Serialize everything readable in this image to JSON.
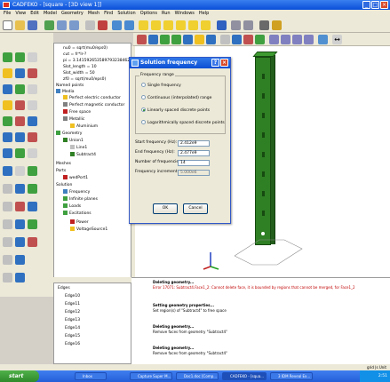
{
  "window": {
    "title": "CADFEKO - [square - [3D view 1]]"
  },
  "menu": [
    "File",
    "View",
    "Edit",
    "Model",
    "Geometry",
    "Mesh",
    "Find",
    "Solution",
    "Options",
    "Run",
    "Windows",
    "Help"
  ],
  "tree": {
    "items": [
      "nu0 = sqrt(mu0/eps0)",
      "cut = fr*lr-?",
      "pi = 3.141592653589793238462",
      "Slot_length = 10",
      "Slot_width = 50",
      "zf0 = sqrt(mu0/eps0)",
      "Named points",
      "Media",
      "Perfect electric conductor",
      "Perfect magnetic conductor",
      "Free space",
      "Metallic",
      "Aluminium",
      "Geometry",
      "Union1",
      "Line1",
      "Subtract4",
      "Meshes",
      "Ports",
      "wedPort1",
      "Solution",
      "Frequency",
      "Infinite planes",
      "Loads",
      "Excitations",
      "Power",
      "VoltageSource1"
    ]
  },
  "lower_tree": {
    "items": [
      "Edges",
      "Edge10",
      "Edge11",
      "Edge12",
      "Edge13",
      "Edge14",
      "Edge15",
      "Edge16"
    ]
  },
  "dialog": {
    "title": "Solution frequency",
    "group_label": "Frequency range",
    "options": [
      "Single frequency",
      "Continuous (interpolated) range",
      "Linearly spaced discrete points",
      "Logarithmically spaced discrete points"
    ],
    "selected_index": 2,
    "start_label": "Start frequency (Hz):",
    "start_value": "2.412e9",
    "end_label": "End frequency (Hz):",
    "end_value": "2.477e9",
    "number_label": "Number of frequencies:",
    "number_value": "14",
    "increment_label": "Frequency increment:",
    "increment_value": "5.000e6",
    "ok_label": "OK",
    "cancel_label": "Cancel"
  },
  "messages": [
    {
      "title": "Deleting geometry...",
      "text": "Error 17071: Subtract4.Face1_2: Cannot delete face, it is bounded by regions that cannot be merged, for Face1_2",
      "error": true
    },
    {
      "title": "Setting geometry properties...",
      "text": "Set region(s) of \"Subtract4\" to free space",
      "error": false
    },
    {
      "title": "Deleting geometry...",
      "text": "Remove faces from geometry \"Subtract4\"",
      "error": false
    },
    {
      "title": "Deleting geometry...",
      "text": "Remove faces from geometry \"Subtract4\"",
      "error": false
    }
  ],
  "status": {
    "text": "grid  |s  Unit"
  },
  "taskbar": {
    "start_label": "start",
    "tasks": [
      "Inbox",
      "Capture Super M...",
      "Doc1.doc [Comp...",
      "CADFEKO - [squa...",
      "3 IDM Reveal Ex..."
    ],
    "clock": "2:51"
  },
  "colors": {
    "model": "#2f7f24",
    "titlebar": "#0a4fd8",
    "error": "#c00000"
  }
}
